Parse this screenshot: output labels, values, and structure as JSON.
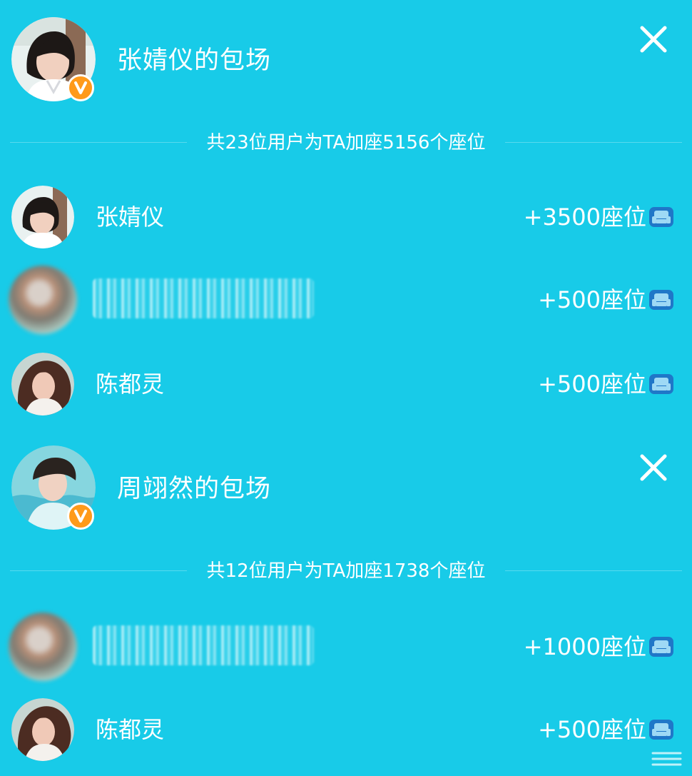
{
  "sections": [
    {
      "title": "张婧仪的包场",
      "summary": "共23位用户为TA加座5156个座位",
      "rows": [
        {
          "name": "张婧仪",
          "seats": "+3500座位"
        },
        {
          "name": "",
          "seats": "+500座位"
        },
        {
          "name": "陈都灵",
          "seats": "+500座位"
        }
      ]
    },
    {
      "title": "周翊然的包场",
      "summary": "共12位用户为TA加座1738个座位",
      "rows": [
        {
          "name": "",
          "seats": "+1000座位"
        },
        {
          "name": "陈都灵",
          "seats": "+500座位"
        }
      ]
    }
  ],
  "colors": {
    "background": "#18cbe8",
    "text": "#ffffff",
    "badge": "#ff9a1a",
    "seat_icon": "#1f77c8"
  },
  "icons": {
    "close": "close-icon",
    "badge": "verified-v-icon",
    "seat": "sofa-seat-icon"
  }
}
